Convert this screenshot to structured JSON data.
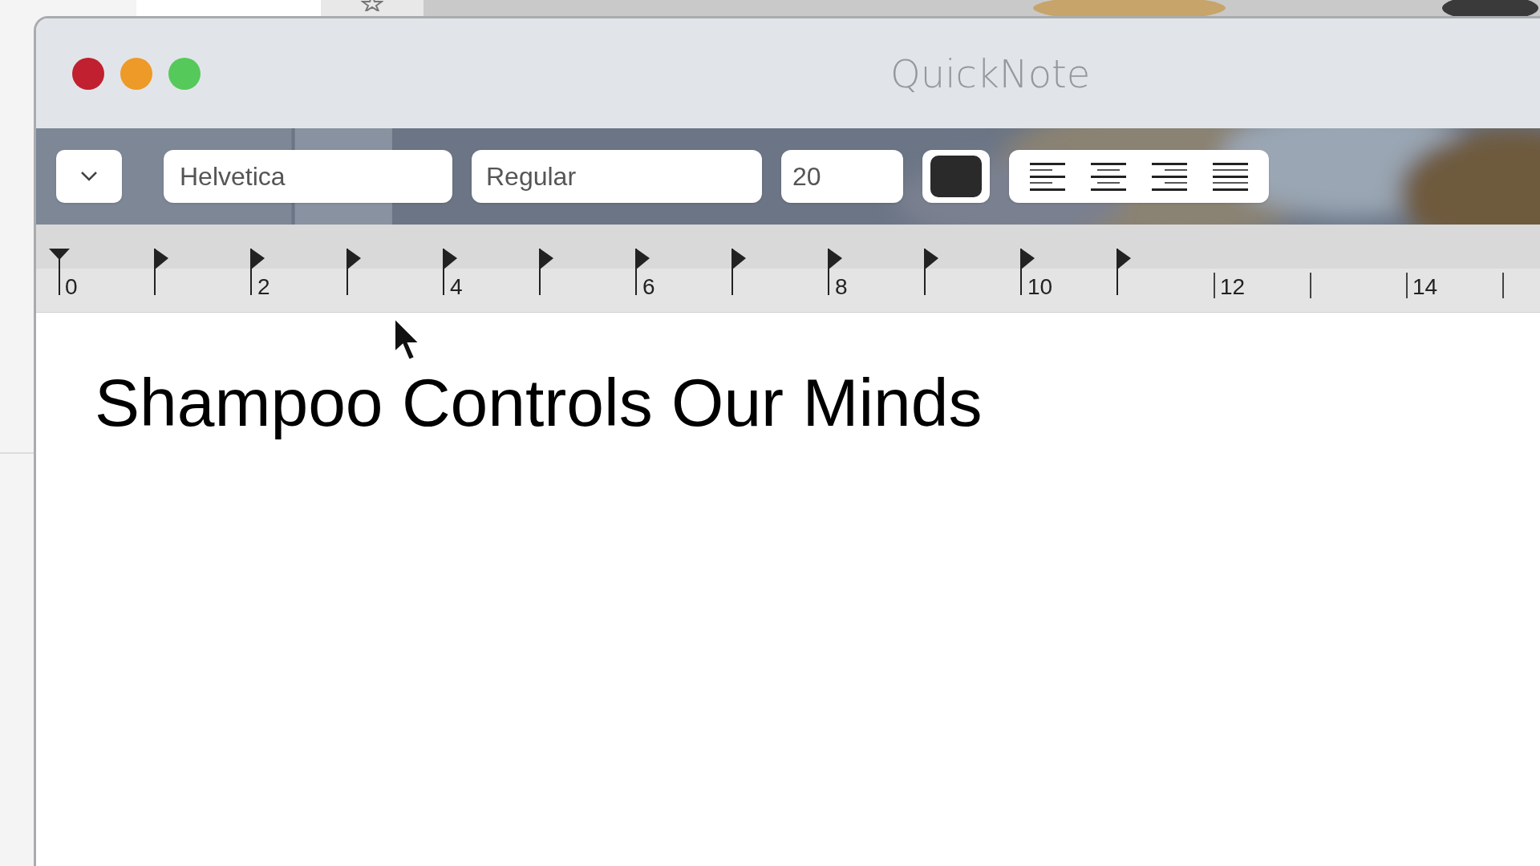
{
  "window": {
    "title": "QuickNote"
  },
  "toolbar": {
    "font_family": "Helvetica",
    "font_style": "Regular",
    "font_size": "20",
    "alignments": [
      {
        "kind": "left"
      },
      {
        "kind": "center"
      },
      {
        "kind": "right"
      },
      {
        "kind": "justify"
      }
    ]
  },
  "ruler": {
    "marks": [
      {
        "kind": "indent",
        "label": "0"
      },
      {
        "kind": "tab"
      },
      {
        "kind": "tab",
        "label": "2"
      },
      {
        "kind": "tab"
      },
      {
        "kind": "tab",
        "label": "4"
      },
      {
        "kind": "tab"
      },
      {
        "kind": "tab",
        "label": "6"
      },
      {
        "kind": "tab"
      },
      {
        "kind": "tab",
        "label": "8"
      },
      {
        "kind": "tab"
      },
      {
        "kind": "tab",
        "label": "10"
      },
      {
        "kind": "tab"
      },
      {
        "kind": "tick",
        "label": "12"
      },
      {
        "kind": "tick"
      },
      {
        "kind": "tick",
        "label": "14"
      },
      {
        "kind": "tick"
      }
    ]
  },
  "document": {
    "text": "Shampoo Controls Our Minds"
  }
}
